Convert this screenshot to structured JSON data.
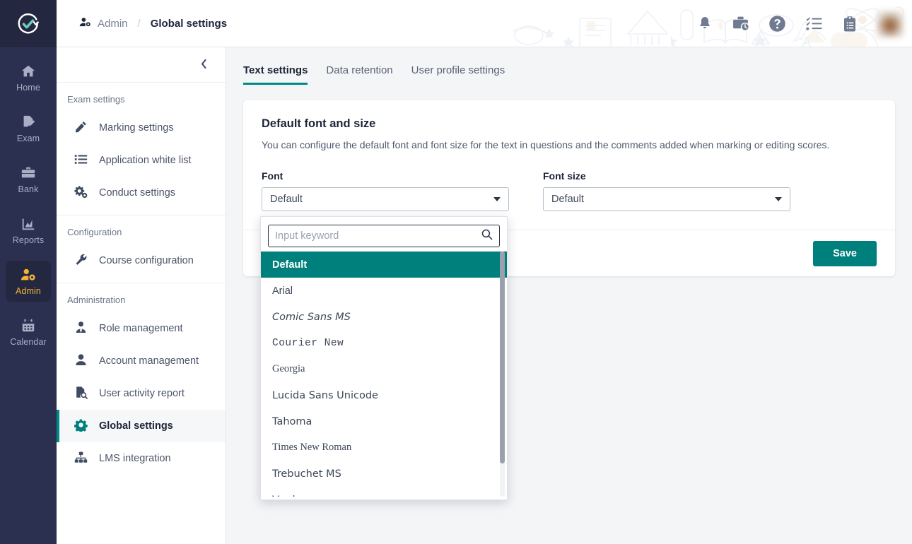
{
  "brand": {
    "logo_icon": "check-circle-arrow-logo",
    "accent_teal": "#00807c",
    "rail_bg": "#2b3050",
    "active_rail_color": "#f5b335"
  },
  "rail": {
    "items": [
      {
        "label": "Home",
        "icon": "home-icon",
        "active": false
      },
      {
        "label": "Exam",
        "icon": "exam-paper-icon",
        "active": false
      },
      {
        "label": "Bank",
        "icon": "toolbox-icon",
        "active": false
      },
      {
        "label": "Reports",
        "icon": "chart-icon",
        "active": false
      },
      {
        "label": "Admin",
        "icon": "user-gear-icon",
        "active": true
      },
      {
        "label": "Calendar",
        "icon": "calendar-icon",
        "active": false
      }
    ]
  },
  "header": {
    "breadcrumb": {
      "icon": "user-gear-icon",
      "parent": "Admin",
      "separator": "/",
      "current": "Global settings"
    },
    "icons": [
      {
        "name": "bell-icon",
        "muted": true
      },
      {
        "name": "briefcase-clock-icon",
        "muted": false
      },
      {
        "name": "help-circle-icon",
        "muted": false
      },
      {
        "name": "checklist-icon",
        "muted": false
      },
      {
        "name": "clipboard-icon",
        "muted": false
      }
    ],
    "avatar": "user-avatar"
  },
  "subnav": {
    "collapse_icon": "chevron-left-icon",
    "groups": [
      {
        "heading": "Exam settings",
        "items": [
          {
            "label": "Marking settings",
            "icon": "pencil-icon",
            "active": false
          },
          {
            "label": "Application white list",
            "icon": "list-icon",
            "active": false
          },
          {
            "label": "Conduct settings",
            "icon": "gears-icon",
            "active": false
          }
        ]
      },
      {
        "heading": "Configuration",
        "items": [
          {
            "label": "Course configuration",
            "icon": "wrench-icon",
            "active": false
          }
        ]
      },
      {
        "heading": "Administration",
        "items": [
          {
            "label": "Role management",
            "icon": "user-tie-icon",
            "active": false
          },
          {
            "label": "Account management",
            "icon": "user-icon",
            "active": false
          },
          {
            "label": "User activity report",
            "icon": "document-search-icon",
            "active": false
          },
          {
            "label": "Global settings",
            "icon": "gear-icon",
            "active": true
          },
          {
            "label": "LMS integration",
            "icon": "sitemap-icon",
            "active": false
          }
        ]
      }
    ]
  },
  "main": {
    "tabs": [
      {
        "label": "Text settings",
        "active": true
      },
      {
        "label": "Data retention",
        "active": false
      },
      {
        "label": "User profile settings",
        "active": false
      }
    ],
    "card": {
      "title": "Default font and size",
      "description": "You can configure the default font and font size for the text in questions and the comments added when marking or editing scores.",
      "font_field": {
        "label": "Font",
        "value": "Default"
      },
      "font_size_field": {
        "label": "Font size",
        "value": "Default"
      },
      "save_label": "Save"
    }
  },
  "dropdown": {
    "open": true,
    "search_placeholder": "Input keyword",
    "search_value": "",
    "search_icon": "search-icon",
    "selected": "Default",
    "options": [
      {
        "label": "Default",
        "css": "ff-default",
        "selected": true
      },
      {
        "label": "Arial",
        "css": "ff-arial",
        "selected": false
      },
      {
        "label": "Comic Sans MS",
        "css": "ff-comic",
        "selected": false
      },
      {
        "label": "Courier New",
        "css": "ff-courier",
        "selected": false
      },
      {
        "label": "Georgia",
        "css": "ff-georgia",
        "selected": false
      },
      {
        "label": "Lucida Sans Unicode",
        "css": "ff-lucida",
        "selected": false
      },
      {
        "label": "Tahoma",
        "css": "ff-tahoma",
        "selected": false
      },
      {
        "label": "Times New Roman",
        "css": "ff-times",
        "selected": false
      },
      {
        "label": "Trebuchet MS",
        "css": "ff-trebuchet",
        "selected": false
      },
      {
        "label": "Verdana",
        "css": "ff-verdana",
        "selected": false
      }
    ]
  }
}
